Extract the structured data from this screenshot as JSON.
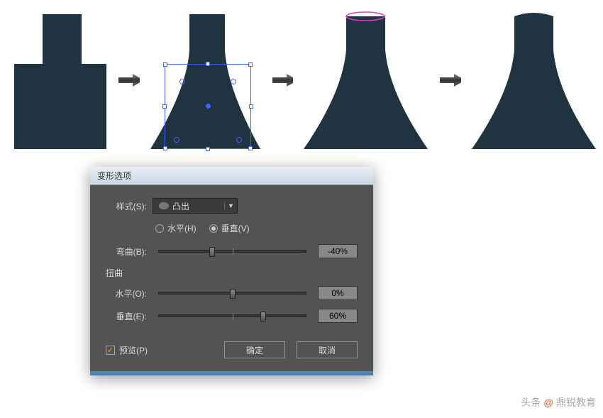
{
  "dialog": {
    "title": "变形选项",
    "style_label": "样式(S):",
    "style_value": "凸出",
    "radio_h": "水平(H)",
    "radio_v": "垂直(V)",
    "bend_label": "弯曲(B):",
    "bend_value": "-40%",
    "distort_title": "扭曲",
    "h_label": "水平(O):",
    "h_value": "0%",
    "v_label": "垂直(E):",
    "v_value": "60%",
    "preview": "预览(P)",
    "ok": "确定",
    "cancel": "取消"
  },
  "slider_positions": {
    "bend": 36,
    "h": 50,
    "v": 71
  },
  "watermark": {
    "prefix": "头条",
    "at": "@",
    "name": "鼎锐教育"
  },
  "shape_color": "#1f3440",
  "ellipse_color": "#e838c8"
}
